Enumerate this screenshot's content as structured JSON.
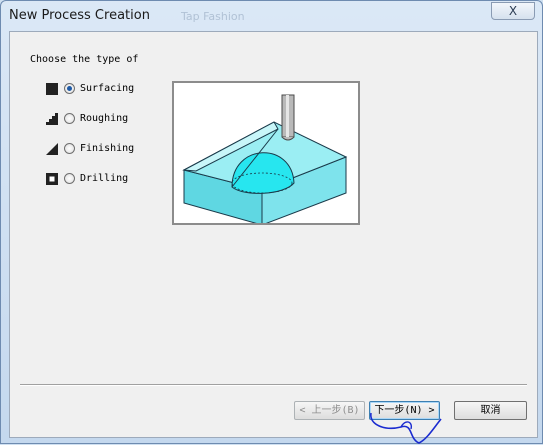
{
  "window": {
    "title": "New Process Creation",
    "ghost_text": "Tap Fashion",
    "close_symbol": "X"
  },
  "prompt": "Choose the type of",
  "options": [
    {
      "label": "Surfacing",
      "icon": "filled-square-icon",
      "selected": true
    },
    {
      "label": "Roughing",
      "icon": "staircase-icon",
      "selected": false
    },
    {
      "label": "Finishing",
      "icon": "slope-triangle-icon",
      "selected": false
    },
    {
      "label": "Drilling",
      "icon": "drill-square-icon",
      "selected": false
    }
  ],
  "buttons": {
    "back": "< 上一步(B)",
    "next": "下一步(N) >",
    "cancel": "取消"
  },
  "colors": {
    "model_fill": "#7fe7ee",
    "model_stroke": "#1a3a4a",
    "ink_scribble": "#1a2bd0"
  }
}
